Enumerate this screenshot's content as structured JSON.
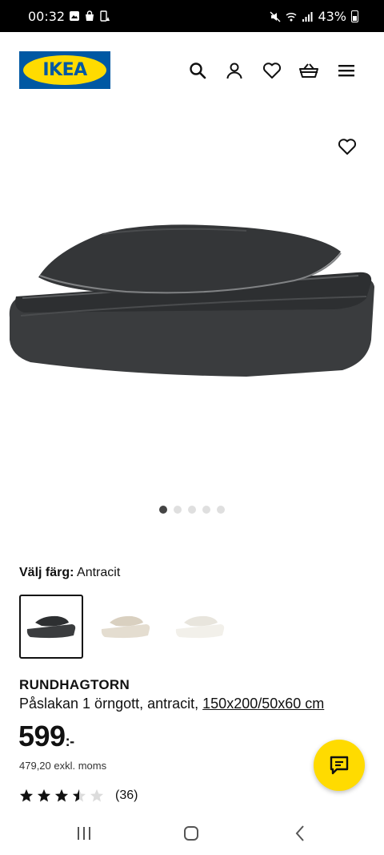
{
  "status_bar": {
    "time": "00:32",
    "battery": "43%"
  },
  "header": {
    "logo_text": "IKEA"
  },
  "gallery": {
    "image_count": 5,
    "active_index": 0
  },
  "color": {
    "label": "Välj färg:",
    "value": "Antracit",
    "options": [
      "Antracit",
      "Beige",
      "Vit"
    ],
    "selected": 0
  },
  "product": {
    "name": "RUNDHAGTORN",
    "description": "Påslakan 1 örngott, antracit,",
    "size": "150x200/50x60 cm",
    "price": "599",
    "currency": ":-",
    "price_ex_vat": "479,20 exkl. moms",
    "rating": 3.5,
    "rating_max": 5,
    "review_count": "(36)"
  },
  "colors": {
    "brand_blue": "#0058a3",
    "brand_yellow": "#ffdb00"
  }
}
